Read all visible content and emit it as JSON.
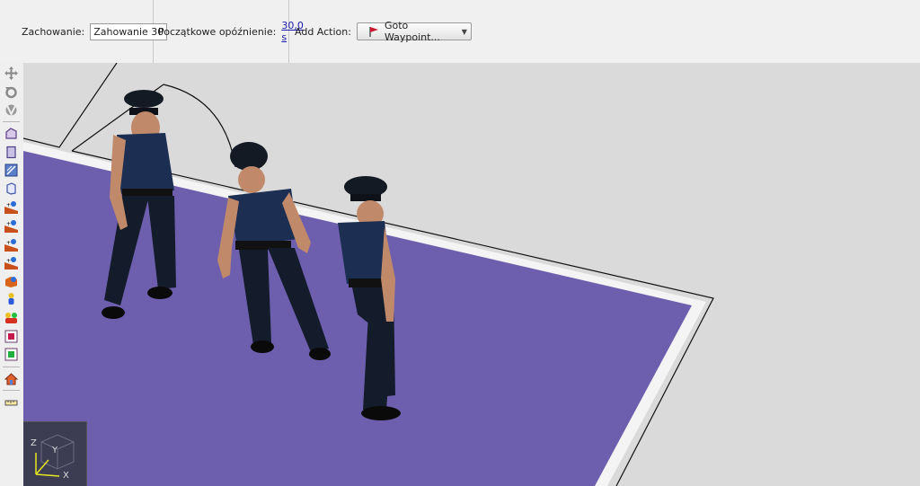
{
  "toolbar_top": {
    "behavior_label": "Zachowanie:",
    "behavior_value": "Zahowanie 30",
    "delay_label": "Początkowe opóźnienie:",
    "delay_value": "30,0 s",
    "add_action_label": "Add Action:",
    "add_action_selected": "Goto Waypoint...",
    "add_action_icon": "red-flag-icon"
  },
  "left_tools": [
    "move-icon",
    "rotate-icon",
    "orbit-icon",
    "polygon-area-icon",
    "rectangle-area-icon",
    "stairs-area-icon",
    "obstacle-icon",
    "spawn-group-icon-1",
    "spawn-group-icon-2",
    "spawn-group-icon-3",
    "spawn-group-icon-4",
    "spawn-box-icon",
    "agent-icon",
    "agent-group-icon",
    "target-red-icon",
    "target-green-icon",
    "house-icon",
    "ruler-icon"
  ],
  "scene": {
    "floor_color": "#6e5fae",
    "ground_color": "#dadada",
    "characters": [
      "police-officer-1",
      "police-officer-2",
      "police-officer-3"
    ],
    "axis_labels": {
      "x": "X",
      "y": "Y",
      "z": "Z"
    }
  }
}
